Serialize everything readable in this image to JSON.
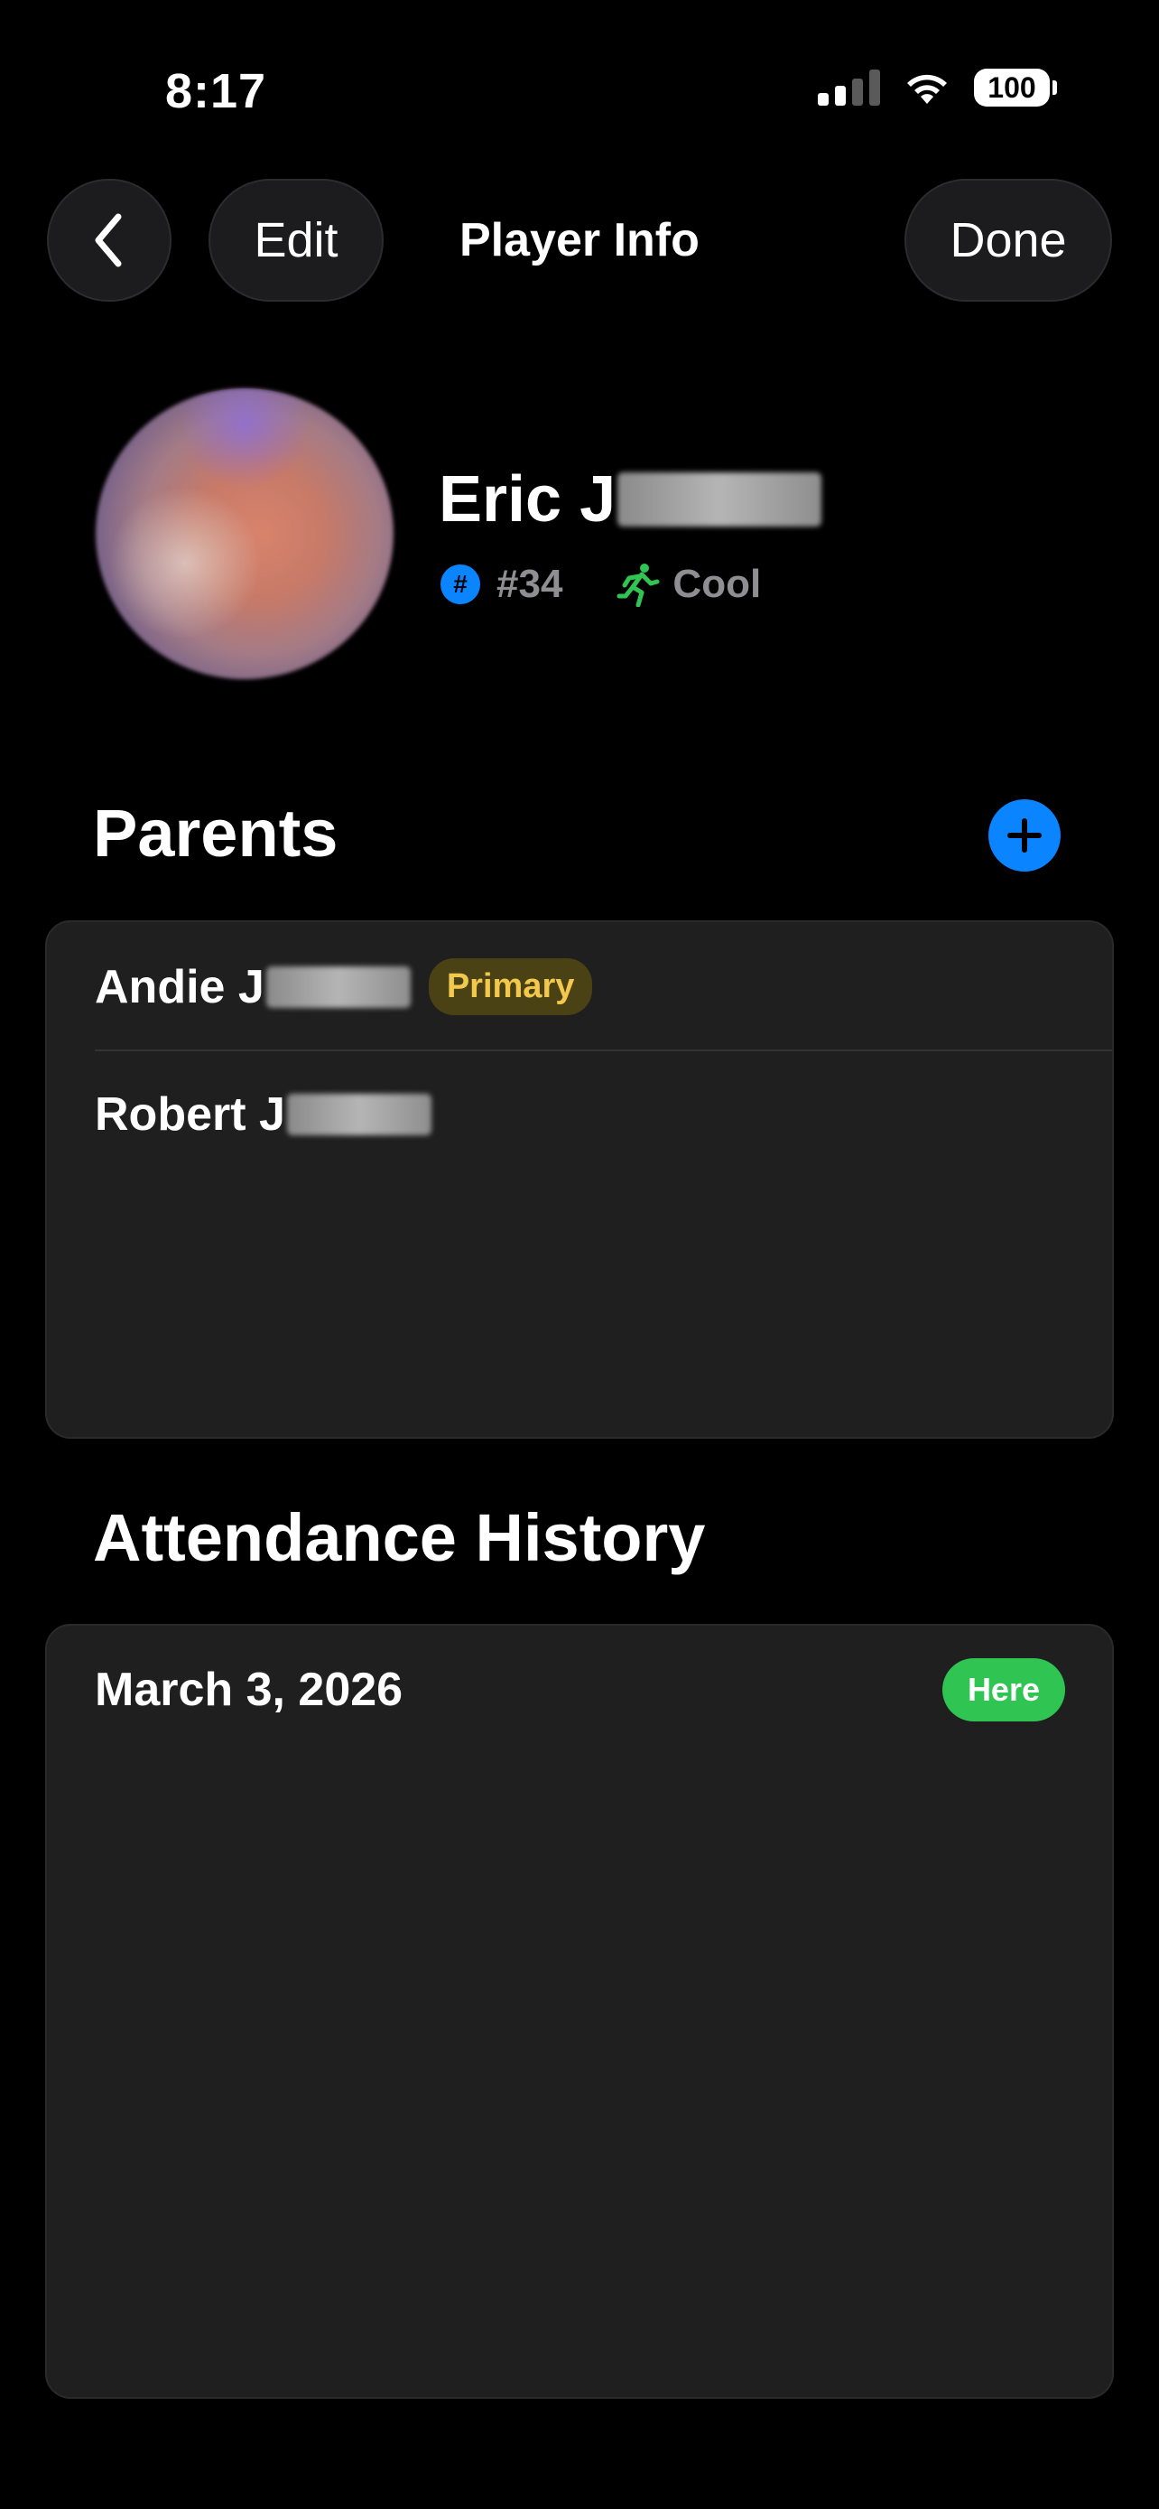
{
  "status_bar": {
    "time": "8:17",
    "battery": "100",
    "signal_icon": "cellular-signal-icon",
    "wifi_icon": "wifi-icon"
  },
  "nav": {
    "back_icon": "chevron-left-icon",
    "edit_label": "Edit",
    "title": "Player Info",
    "done_label": "Done"
  },
  "player": {
    "name_visible": "Eric J",
    "number": "#34",
    "status": "Cool",
    "number_icon": "hash-icon",
    "status_icon": "running-figure-icon",
    "status_color": "#30c552",
    "number_icon_color": "#0a84ff"
  },
  "parents": {
    "title": "Parents",
    "add_icon": "plus-icon",
    "items": [
      {
        "name_visible": "Andie J",
        "badge": "Primary"
      },
      {
        "name_visible": "Robert J",
        "badge": ""
      }
    ]
  },
  "attendance": {
    "title": "Attendance History",
    "items": [
      {
        "date": "March 3, 2026",
        "status": "Here",
        "status_color": "#30c552"
      }
    ]
  },
  "colors": {
    "background": "#000000",
    "card": "#1f1f1f",
    "accent_blue": "#0a84ff",
    "primary_badge_text": "#f2c94c"
  }
}
